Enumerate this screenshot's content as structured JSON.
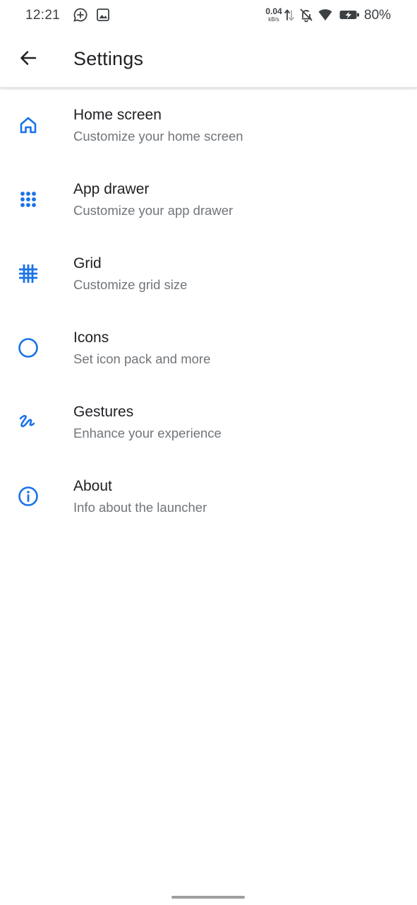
{
  "status_bar": {
    "time": "12:21",
    "notification_icons": [
      "whatsapp-icon",
      "image-icon"
    ],
    "net_speed_value": "0.04",
    "net_speed_unit": "kB/s",
    "system_icons": [
      "upload-download-arrows-icon",
      "bell-off-icon",
      "wifi-icon",
      "battery-charging-icon"
    ],
    "battery_percent": "80%"
  },
  "app_bar": {
    "back_icon": "arrow-back-icon",
    "title": "Settings"
  },
  "colors": {
    "accent": "#1a73e8",
    "title_text": "#202124",
    "subtitle_text": "#70757a",
    "status_text": "#3c4043"
  },
  "settings_items": [
    {
      "icon": "home-icon",
      "title": "Home screen",
      "subtitle": "Customize your home screen"
    },
    {
      "icon": "app-drawer-icon",
      "title": "App drawer",
      "subtitle": "Customize your app drawer"
    },
    {
      "icon": "grid-icon",
      "title": "Grid",
      "subtitle": "Customize grid size"
    },
    {
      "icon": "circle-icon",
      "title": "Icons",
      "subtitle": "Set icon pack and more"
    },
    {
      "icon": "gesture-icon",
      "title": "Gestures",
      "subtitle": "Enhance your experience"
    },
    {
      "icon": "info-icon",
      "title": "About",
      "subtitle": "Info about the launcher"
    }
  ]
}
